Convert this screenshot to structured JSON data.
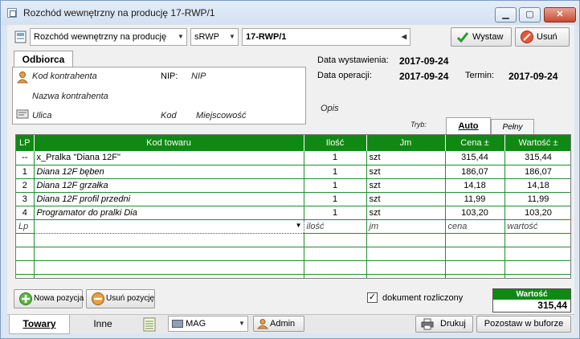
{
  "window": {
    "title": "Rozchód wewnętrzny na producję 17-RWP/1",
    "min_glyph": "▁",
    "max_glyph": "▢",
    "close_glyph": "✕"
  },
  "toolbar": {
    "doc_type": "Rozchód wewnętrzny na producję",
    "series": "sRWP",
    "number": "17-RWP/1",
    "issue_label": "Wystaw",
    "delete_label": "Usuń"
  },
  "recipient": {
    "tab_label": "Odbiorca",
    "contractor_code": "Kod kontrahenta",
    "nip_label": "NIP:",
    "nip_value": "NIP",
    "contractor_name": "Nazwa kontrahenta",
    "street": "Ulica",
    "postal_code": "Kod",
    "city": "Miejscowość"
  },
  "dates": {
    "issue_label": "Data wystawienia:",
    "issue_value": "2017-09-24",
    "operation_label": "Data operacji:",
    "operation_value": "2017-09-24",
    "term_label": "Termin:",
    "term_value": "2017-09-24"
  },
  "description_label": "Opis",
  "mode": {
    "label": "Tryb:",
    "tabs": [
      "Auto",
      "Pełny"
    ],
    "active": "Auto"
  },
  "grid": {
    "columns": [
      "LP",
      "Kod towaru",
      "Ilość",
      "Jm",
      "Cena ±",
      "Wartość ±"
    ],
    "rows": [
      {
        "lp": "--",
        "code": "x_Pralka \"Diana 12F\"",
        "qty": "1",
        "unit": "szt",
        "price": "315,44",
        "value": "315,44",
        "italic": false
      },
      {
        "lp": "1",
        "code": "Diana 12F bęben",
        "qty": "1",
        "unit": "szt",
        "price": "186,07",
        "value": "186,07",
        "italic": true
      },
      {
        "lp": "2",
        "code": "Diana 12F grzałka",
        "qty": "1",
        "unit": "szt",
        "price": "14,18",
        "value": "14,18",
        "italic": true
      },
      {
        "lp": "3",
        "code": "Diana 12F profil przedni",
        "qty": "1",
        "unit": "szt",
        "price": "11,99",
        "value": "11,99",
        "italic": true
      },
      {
        "lp": "4",
        "code": "Programator do pralki Dia",
        "qty": "1",
        "unit": "szt",
        "price": "103,20",
        "value": "103,20",
        "italic": true
      }
    ],
    "new_row": {
      "lp": "Lp",
      "qty": "ilość",
      "unit": "jm",
      "price": "cena",
      "value": "wartość"
    }
  },
  "actions": {
    "add_position": "Nowa pozycja",
    "remove_position": "Usuń pozycję",
    "settlement_label": "dokument rozliczony",
    "settlement_checked": true
  },
  "total": {
    "label": "Wartość",
    "value": "315,44"
  },
  "bottom": {
    "tab_goods": "Towary",
    "tab_other": "Inne",
    "warehouse": "MAG",
    "user": "Admin",
    "print_label": "Drukuj",
    "buffer_label": "Pozostaw w buforze"
  },
  "colors": {
    "grid_header": "#0e8a14",
    "grid_lines": "#1f8f2f"
  }
}
